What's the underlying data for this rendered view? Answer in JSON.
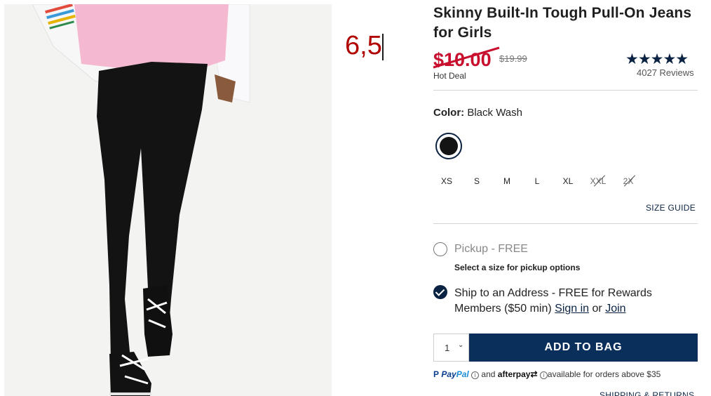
{
  "product": {
    "title": "Skinny Built-In Tough Pull-On Jeans for Girls",
    "sale_price": "$10.00",
    "regular_price": "$19.99",
    "deal_label": "Hot Deal",
    "rating_stars": "★★★★★",
    "rating_value": 4.5,
    "reviews": "4027 Reviews"
  },
  "annotation": {
    "text": "6,5"
  },
  "color": {
    "label": "Color:",
    "value": "Black Wash",
    "swatch_color": "#141414"
  },
  "sizes": [
    {
      "label": "XS",
      "available": true
    },
    {
      "label": "S",
      "available": true
    },
    {
      "label": "M",
      "available": true
    },
    {
      "label": "L",
      "available": true
    },
    {
      "label": "XL",
      "available": true
    },
    {
      "label": "XXL",
      "available": false
    },
    {
      "label": "2X",
      "available": false
    }
  ],
  "size_guide": "SIZE GUIDE",
  "fulfillment": {
    "pickup_label": "Pickup - FREE",
    "pickup_note": "Select a size for pickup options",
    "ship_text": "Ship to an Address - FREE for Rewards Members ($50 min)",
    "sign_in": "Sign in",
    "or": "or",
    "join": "Join"
  },
  "cart": {
    "quantity": "1",
    "add_to_bag": "ADD TO BAG"
  },
  "payment": {
    "paypal_a": "Pay",
    "paypal_b": "Pal",
    "and": "and",
    "afterpay": "afterpay",
    "note": "available for orders above $35"
  },
  "shipping_returns": "SHIPPING & RETURNS",
  "colors": {
    "navy": "#0a2342",
    "sale_red": "#c8102e",
    "button_bg": "#0a2f5b"
  }
}
